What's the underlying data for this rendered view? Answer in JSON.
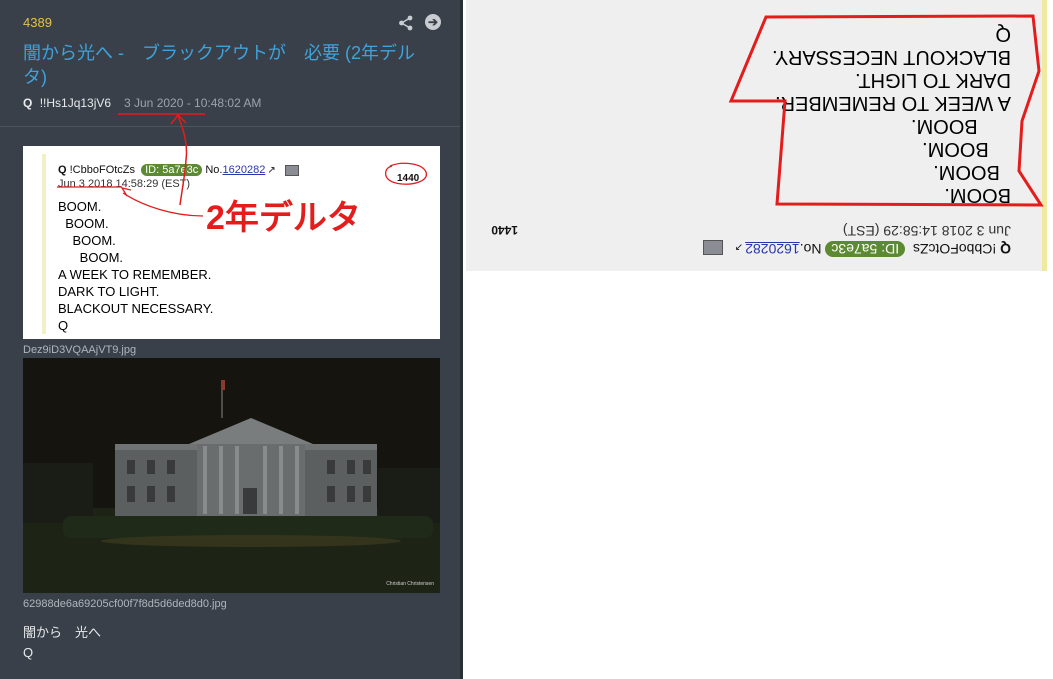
{
  "post": {
    "number": "4389",
    "title": "闇から光へ -　ブラックアウトが　必要 (2年デルタ)",
    "author": "Q",
    "tripcode": "!!Hs1Jq13jV6",
    "date": "3 Jun 2020 - 10:48:02 AM",
    "message_lines": [
      "闇から　光へ",
      "Q"
    ]
  },
  "icons": {
    "share": "share-icon",
    "open": "arrow-right-circle-icon"
  },
  "quoted": {
    "name": "Q",
    "tripcode": "!CbboFOtcZs",
    "id_badge": "ID: 5a7e3c",
    "post_no_prefix": "No.",
    "post_no": "1620282",
    "date": "Jun 3 2018 14:58:29 (EST)",
    "count": "1440",
    "body": "BOOM.\n  BOOM.\n    BOOM.\n      BOOM.\nA WEEK TO REMEMBER.\nDARK TO LIGHT.\nBLACKOUT NECESSARY.\nQ",
    "delta_annotation": "2年デルタ"
  },
  "images": [
    {
      "filename": "Dez9iD3VQAAjVT9.jpg"
    },
    {
      "filename": "62988de6a69205cf00f7f8d5d6ded8d0.jpg",
      "credit": "Christian Christensen"
    }
  ],
  "colors": {
    "panel_bg": "#394049",
    "post_number": "#e5c14b",
    "title_link": "#3fa2dc",
    "id_badge": "#5b8a32",
    "annotation_red": "#e31c1c"
  }
}
